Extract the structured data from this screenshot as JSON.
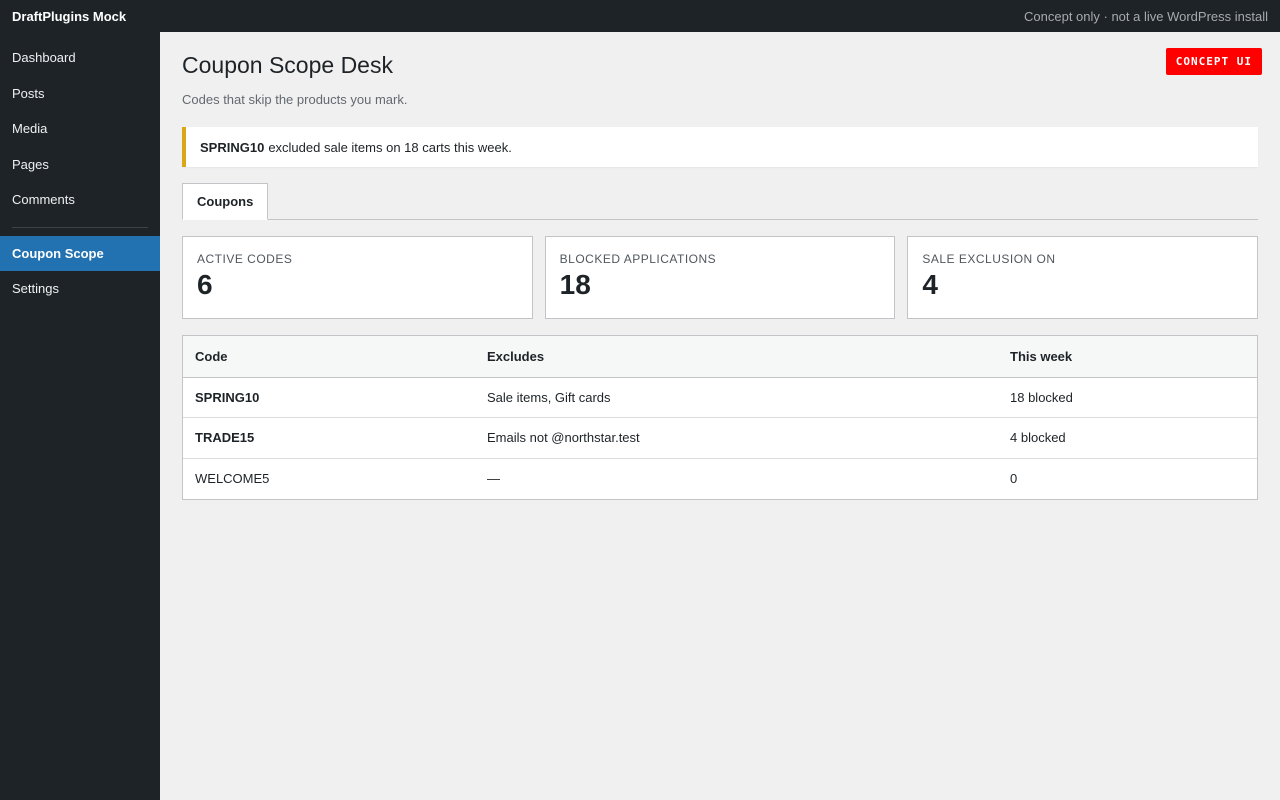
{
  "topbar": {
    "brand": "DraftPlugins Mock",
    "note": "Concept only · not a live WordPress install"
  },
  "sidebar": {
    "items": [
      {
        "label": "Dashboard"
      },
      {
        "label": "Posts"
      },
      {
        "label": "Media"
      },
      {
        "label": "Pages"
      },
      {
        "label": "Comments"
      }
    ],
    "plugin_items": [
      {
        "label": "Coupon Scope",
        "active": true
      },
      {
        "label": "Settings"
      }
    ]
  },
  "page": {
    "title": "Coupon Scope Desk",
    "subtitle": "Codes that skip the products you mark.",
    "badge": "CONCEPT UI"
  },
  "notice": {
    "code": "SPRING10",
    "message": "excluded sale items on 18 carts this week."
  },
  "tabs": [
    {
      "label": "Coupons",
      "active": true
    }
  ],
  "stats": [
    {
      "label": "Active codes",
      "value": "6"
    },
    {
      "label": "Blocked applications",
      "value": "18"
    },
    {
      "label": "Sale exclusion on",
      "value": "4"
    }
  ],
  "table": {
    "headers": [
      "Code",
      "Excludes",
      "This week"
    ],
    "rows": [
      {
        "code": "SPRING10",
        "excludes": "Sale items, Gift cards",
        "week": "18 blocked",
        "bold": true
      },
      {
        "code": "TRADE15",
        "excludes": "Emails not @northstar.test",
        "week": "4 blocked",
        "bold": true
      },
      {
        "code": "WELCOME5",
        "excludes": "—",
        "week": "0",
        "bold": false
      }
    ]
  },
  "colors": {
    "admin_bar": "#1d2327",
    "accent": "#2271b1",
    "notice_border": "#dba617",
    "badge": "#ff0000"
  }
}
